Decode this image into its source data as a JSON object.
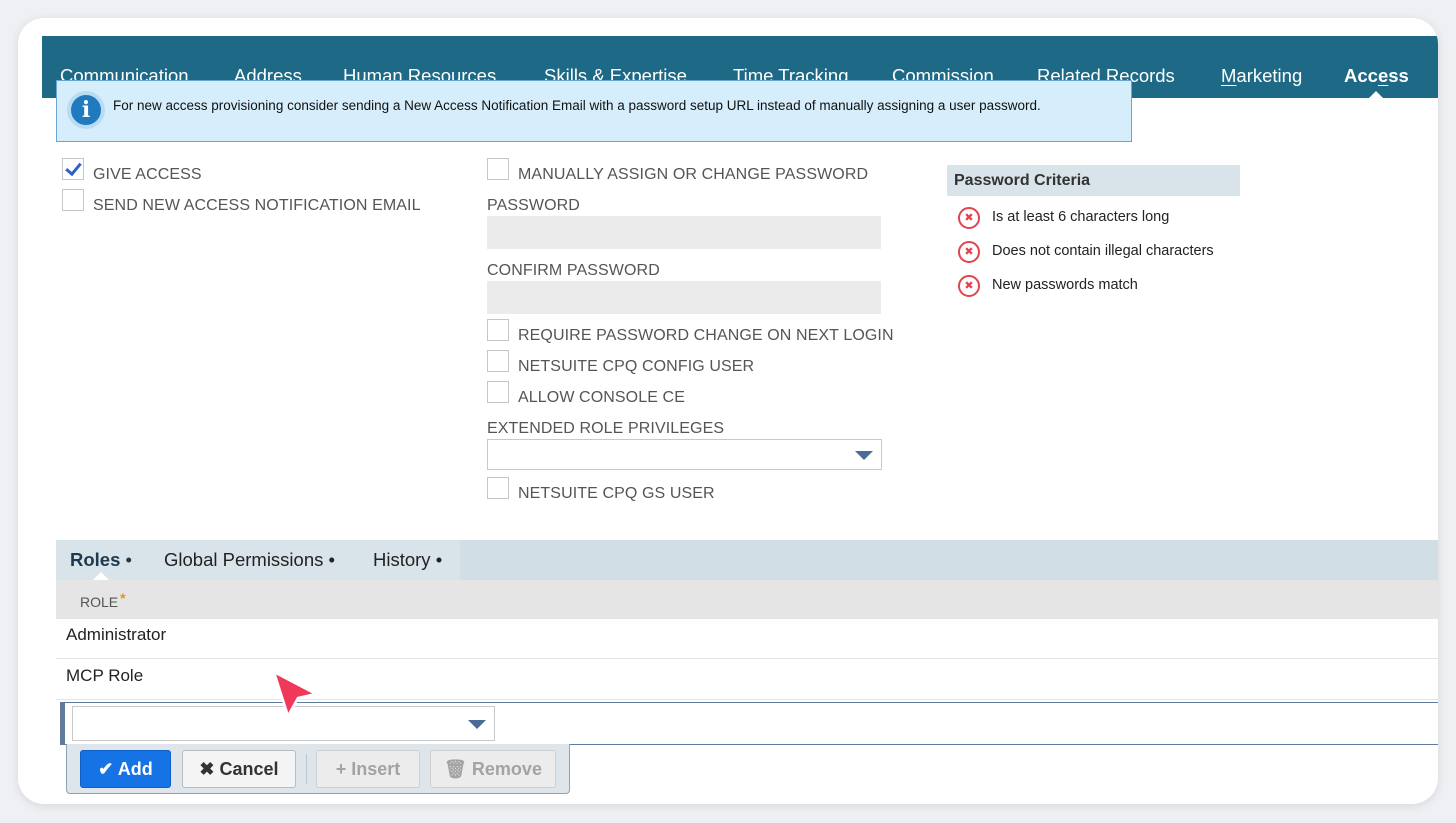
{
  "subtabs": [
    {
      "first": "C",
      "rest": "ommunication",
      "full": "Communication"
    },
    {
      "first": "A",
      "rest": "ddress",
      "full": "Address"
    },
    {
      "first": "H",
      "rest": "uman Resources",
      "full": "Human Resources"
    },
    {
      "first": "S",
      "rest": "kills & Expertise",
      "full": "Skills & Expertise"
    },
    {
      "first": "T",
      "rest": "ime Tracking",
      "full": "Time Tracking"
    },
    {
      "pre": "C",
      "first": "o",
      "rest": "mmission",
      "full": "Commission"
    },
    {
      "first": "R",
      "rest": "elated Records",
      "full": "Related Records"
    },
    {
      "first": "M",
      "rest": "arketing",
      "full": "Marketing"
    },
    {
      "pre": "Acc",
      "first": "e",
      "rest": "ss",
      "full": "Access",
      "active": true
    }
  ],
  "banner": {
    "icon": "info-icon",
    "text": "For new access provisioning consider sending a New Access Notification Email with a password setup URL instead of manually assigning a user password."
  },
  "access": {
    "give_access": {
      "label": "GIVE ACCESS",
      "checked": true
    },
    "send_notification": {
      "label": "SEND NEW ACCESS NOTIFICATION EMAIL",
      "checked": false
    },
    "manually_assign": {
      "label": "MANUALLY ASSIGN OR CHANGE PASSWORD",
      "checked": false
    },
    "password_label": "PASSWORD",
    "password_value": "",
    "confirm_label": "CONFIRM PASSWORD",
    "confirm_value": "",
    "require_change": {
      "label": "REQUIRE PASSWORD CHANGE ON NEXT LOGIN",
      "checked": false
    },
    "cpq_config_user": {
      "label": "NETSUITE CPQ CONFIG USER",
      "checked": false
    },
    "allow_console": {
      "label": "ALLOW CONSOLE CE",
      "checked": false
    },
    "extended_role_label": "EXTENDED ROLE PRIVILEGES",
    "extended_role_value": "",
    "cpq_gs_user": {
      "label": "NETSUITE CPQ GS USER",
      "checked": false
    }
  },
  "criteria": {
    "title": "Password Criteria",
    "items": [
      {
        "text": "Is at least 6 characters long",
        "status": "fail"
      },
      {
        "text": "Does not contain illegal characters",
        "status": "fail"
      },
      {
        "text": "New passwords match",
        "status": "fail"
      }
    ]
  },
  "roles": {
    "tabs": [
      {
        "label": "Roles",
        "dot": "•",
        "active": true
      },
      {
        "label": "Global Permissions",
        "dot": "•"
      },
      {
        "label": "History",
        "dot": "•"
      }
    ],
    "column_header": "ROLE",
    "required_mark": "*",
    "rows": [
      "Administrator",
      "MCP Role"
    ],
    "new_role_value": "",
    "buttons": {
      "add": "Add",
      "cancel": "Cancel",
      "insert": "Insert",
      "remove": "Remove"
    }
  },
  "colors": {
    "subtab_bar": "#1e6a86",
    "banner_bg": "#d6eefb",
    "add_button": "#1673e6",
    "criteria_fail": "#e2434f",
    "checkmark": "#2d61c9",
    "required_star": "#e69317",
    "cursor": "#f0385a"
  }
}
